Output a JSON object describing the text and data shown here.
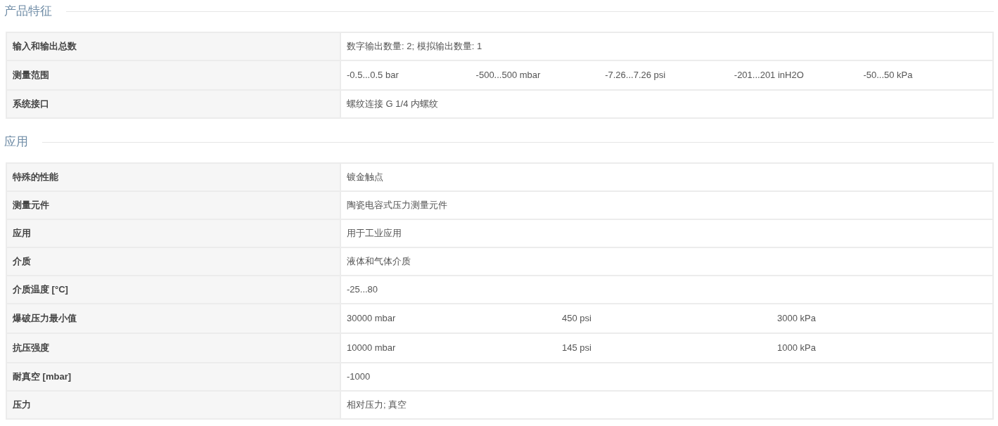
{
  "sections": [
    {
      "title": "产品特征",
      "rows": [
        {
          "label": "输入和输出总数",
          "values": [
            "数字输出数量: 2; 模拟输出数量: 1"
          ]
        },
        {
          "label": "测量范围",
          "values": [
            "-0.5...0.5 bar",
            "-500...500 mbar",
            "-7.26...7.26 psi",
            "-201...201 inH2O",
            "-50...50 kPa"
          ]
        },
        {
          "label": "系统接口",
          "values": [
            "螺纹连接 G 1/4 内螺纹"
          ]
        }
      ]
    },
    {
      "title": "应用",
      "rows": [
        {
          "label": "特殊的性能",
          "values": [
            "镀金触点"
          ]
        },
        {
          "label": "测量元件",
          "values": [
            "陶瓷电容式压力测量元件"
          ]
        },
        {
          "label": "应用",
          "values": [
            "用于工业应用"
          ]
        },
        {
          "label": "介质",
          "values": [
            "液体和气体介质"
          ]
        },
        {
          "label": "介质温度 [°C]",
          "values": [
            "-25...80"
          ]
        },
        {
          "label": "爆破压力最小值",
          "values": [
            "30000 mbar",
            "450 psi",
            "3000 kPa"
          ]
        },
        {
          "label": "抗压强度",
          "values": [
            "10000 mbar",
            "145 psi",
            "1000 kPa"
          ]
        },
        {
          "label": "耐真空 [mbar]",
          "values": [
            "-1000"
          ]
        },
        {
          "label": "压力",
          "values": [
            "相对压力; 真空"
          ]
        }
      ]
    }
  ]
}
